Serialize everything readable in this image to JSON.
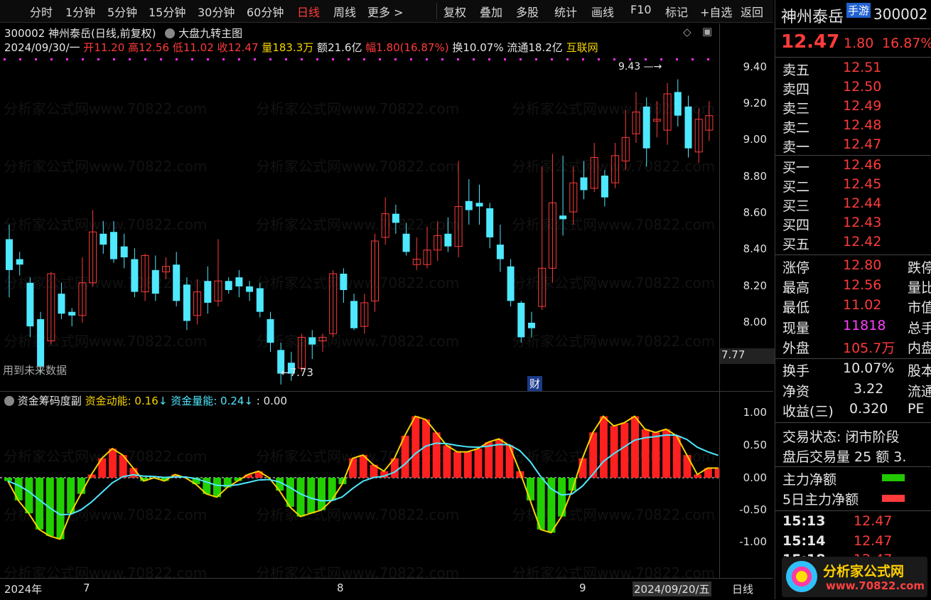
{
  "toolbar": {
    "items": [
      "分时",
      "1分钟",
      "5分钟",
      "15分钟",
      "30分钟",
      "60分钟",
      "日线",
      "周线",
      "更多 >",
      "复权",
      "叠加",
      "多股",
      "统计",
      "画线",
      "F10",
      "标记",
      "+自选",
      "返回"
    ],
    "active": "日线"
  },
  "header": {
    "code": "300002 神州泰岳(日线,前复权)",
    "indicator": "大盘九转主图",
    "date": "2024/09/30/一",
    "open_label": "开",
    "open": "11.20",
    "high_label": "高",
    "high": "12.56",
    "low_label": "低",
    "low": "11.02",
    "close_label": "收",
    "close": "12.47",
    "vol_label": "量",
    "vol": "183.3万",
    "amt_label": "额",
    "amt": "21.6亿",
    "chg_label": "幅",
    "chg": "1.80(16.87%)",
    "turn_label": "换",
    "turn": "10.07%",
    "float_label": "流通",
    "float": "18.2亿",
    "sector": "互联网"
  },
  "main_chart": {
    "y_ticks": [
      "9.40",
      "9.20",
      "9.00",
      "8.80",
      "8.60",
      "8.40",
      "8.20",
      "8.00"
    ],
    "current_price_tag": "7.77",
    "low_annotation": "←7.73",
    "high_annotation": "9.43 —→",
    "future_note": "用到未来数据",
    "cai_label": "财"
  },
  "sub_chart": {
    "title": "资金筹码度副",
    "line1_label": "资金动能:",
    "line1_val": "0.16",
    "line2_label": "资金量能:",
    "line2_val": "0.24",
    "line3": ": 0.00",
    "y_ticks": [
      "1.00",
      "0.50",
      "0.00",
      "-0.50",
      "-1.00"
    ]
  },
  "x_axis": {
    "labels": [
      "2024年",
      "7",
      "8",
      "9",
      "2024/09/20/五"
    ],
    "period": "日线"
  },
  "right_panel": {
    "name": "神州泰岳",
    "badge": "手游",
    "code": "300002",
    "price": "12.47",
    "change": "1.80",
    "pct": "16.87%",
    "asks": [
      [
        "卖五",
        "12.51"
      ],
      [
        "卖四",
        "12.50"
      ],
      [
        "卖三",
        "12.49"
      ],
      [
        "卖二",
        "12.48"
      ],
      [
        "卖一",
        "12.47"
      ]
    ],
    "bids": [
      [
        "买一",
        "12.46"
      ],
      [
        "买二",
        "12.45"
      ],
      [
        "买三",
        "12.44"
      ],
      [
        "买四",
        "12.43"
      ],
      [
        "买五",
        "12.42"
      ]
    ],
    "stats": [
      [
        "涨停",
        "12.80",
        "跌停"
      ],
      [
        "最高",
        "12.56",
        "量比"
      ],
      [
        "最低",
        "11.02",
        "市值"
      ],
      [
        "现量",
        "11818",
        "总手"
      ],
      [
        "外盘",
        "105.7万",
        "内盘"
      ]
    ],
    "stats2": [
      [
        "换手",
        "10.07%",
        "股本"
      ],
      [
        "净资",
        "3.22",
        "流通"
      ],
      [
        "收益(三)",
        "0.320",
        "PE"
      ]
    ],
    "trade_state": "交易状态: 闭市阶段",
    "after_hours": "盘后交易量 25 额 3.",
    "main_net": "主力净额",
    "main_net5": "5日主力净额",
    "ticks": [
      [
        "15:13",
        "12.47"
      ],
      [
        "15:14",
        "12.47"
      ],
      [
        "15:18",
        "12.47"
      ]
    ]
  },
  "logo": {
    "text": "分析家公式网",
    "url": "www.70822.com"
  },
  "watermark": "分析家公式网www.70822.com",
  "colors": {
    "up": "#ff3b3b",
    "down": "#4ee8ff",
    "yellow": "#f5d400",
    "green": "#22c800",
    "magenta": "#ff30ff"
  }
}
